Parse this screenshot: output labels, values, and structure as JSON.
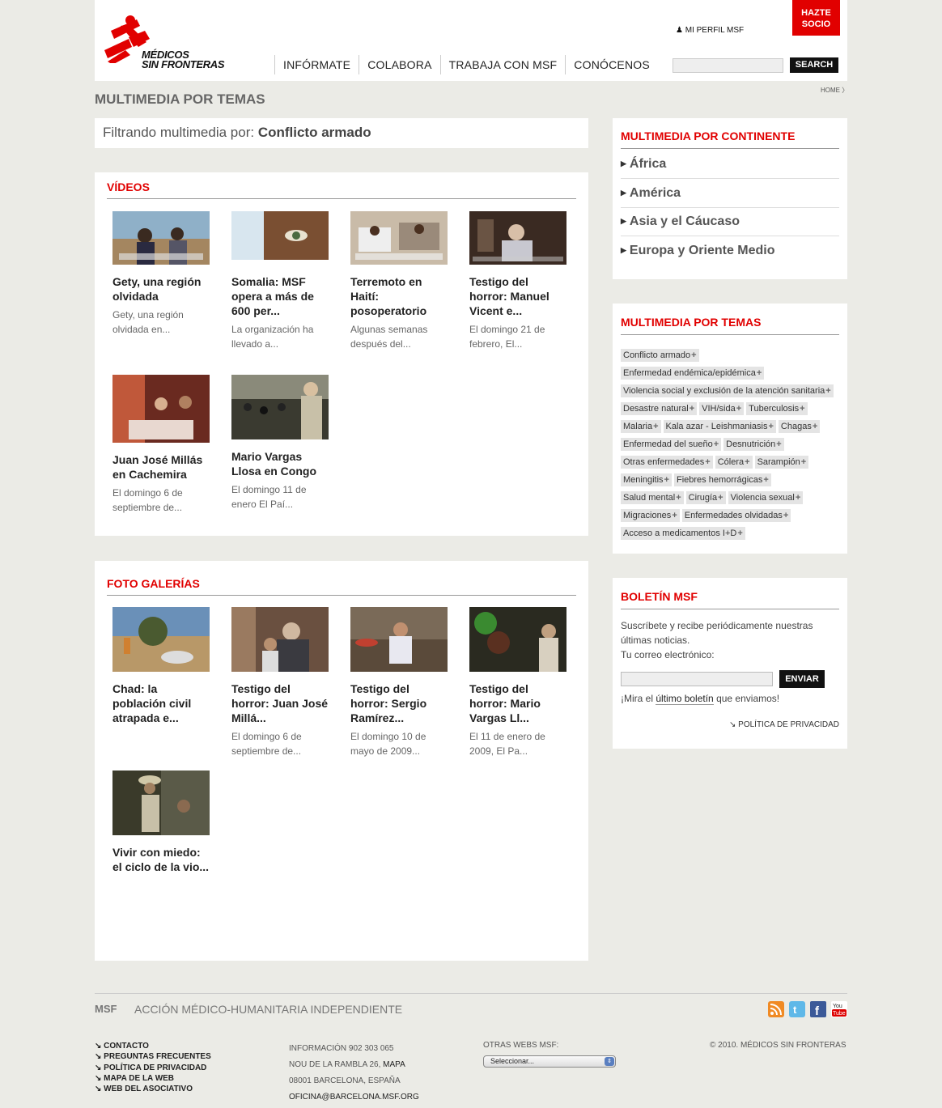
{
  "header": {
    "logo_line1": "MÉDICOS",
    "logo_line2": "SIN FRONTERAS",
    "hazte_line1": "HAZTE",
    "hazte_line2": "SOCIO",
    "perfil": "MI PERFIL MSF",
    "nav": [
      "INFÓRMATE",
      "COLABORA",
      "TRABAJA CON MSF",
      "CONÓCENOS"
    ],
    "search_button": "SEARCH"
  },
  "page": {
    "title": "MULTIMEDIA POR TEMAS",
    "breadcrumb": "HOME 〉",
    "filter_prefix": "Filtrando multimedia por:",
    "filter_value": "Conflicto armado"
  },
  "videos": {
    "heading": "VÍDEOS",
    "items": [
      {
        "title": "Gety, una región olvidada",
        "desc": "Gety, una región olvidada en..."
      },
      {
        "title": "Somalia: MSF opera a más de 600 per...",
        "desc": "La organización ha llevado a..."
      },
      {
        "title": "Terremoto en Haití: posoperatorio",
        "desc": "Algunas semanas después del..."
      },
      {
        "title": "Testigo del horror: Manuel Vicent e...",
        "desc": "El domingo 21 de febrero, El..."
      },
      {
        "title": "Juan José Millás en Cachemira",
        "desc": "El domingo 6 de septiembre de..."
      },
      {
        "title": "Mario Vargas Llosa en Congo",
        "desc": "El domingo 11 de enero El Paí..."
      }
    ]
  },
  "galleries": {
    "heading": "FOTO GALERÍAS",
    "items": [
      {
        "title": "Chad: la población civil atrapada e...",
        "desc": ""
      },
      {
        "title": "Testigo del horror: Juan José Millá...",
        "desc": "El domingo 6 de septiembre de..."
      },
      {
        "title": "Testigo del horror: Sergio Ramírez...",
        "desc": "El domingo 10 de mayo de 2009..."
      },
      {
        "title": "Testigo del horror: Mario Vargas Ll...",
        "desc": "El 11 de enero de 2009, El Pa..."
      },
      {
        "title": "Vivir con miedo: el ciclo de la vio...",
        "desc": ""
      }
    ]
  },
  "sidebar": {
    "continent_heading": "MULTIMEDIA POR CONTINENTE",
    "continents": [
      "África",
      "América",
      "Asia y el Cáucaso",
      "Europa y Oriente Medio"
    ],
    "themes_heading": "MULTIMEDIA POR TEMAS",
    "tags": [
      "Conflicto armado",
      "Enfermedad endémica/epidémica",
      "Violencia social y exclusión de la atención sanitaria",
      "Desastre natural",
      "VIH/sida",
      "Tuberculosis",
      "Malaria",
      "Kala azar - Leishmaniasis",
      "Chagas",
      "Enfermedad del sueño",
      "Desnutrición",
      "Otras enfermedades",
      "Cólera",
      "Sarampión",
      "Meningitis",
      "Fiebres hemorrágicas",
      "Salud mental",
      "Cirugía",
      "Violencia sexual",
      "Migraciones",
      "Enfermedades olvidadas",
      "Acceso a medicamentos I+D"
    ],
    "boletin_heading": "BOLETÍN MSF",
    "boletin_text": "Suscríbete y recibe periódicamente nuestras últimas noticias.",
    "boletin_email_label": "Tu correo electrónico:",
    "boletin_button": "ENVIAR",
    "boletin_link_pre": "¡Mira el",
    "boletin_link": "último boletín",
    "boletin_link_post": "que enviamos!",
    "boletin_privacy": "POLÍTICA DE PRIVACIDAD"
  },
  "footer": {
    "msf": "MSF",
    "tagline": "ACCIÓN MÉDICO-HUMANITARIA INDEPENDIENTE",
    "links": [
      "CONTACTO",
      "PREGUNTAS FRECUENTES",
      "POLÍTICA DE PRIVACIDAD",
      "MAPA DE LA WEB",
      "WEB DEL ASOCIATIVO"
    ],
    "info_phone": "INFORMACIÓN 902 303 065",
    "info_address": "NOU DE LA RAMBLA 26,",
    "info_map": "MAPA",
    "info_city": "08001 BARCELONA, ESPAÑA",
    "info_email": "OFICINA@BARCELONA.MSF.ORG",
    "other_label": "OTRAS WEBS MSF:",
    "select_value": "Seleccionar...",
    "copyright": "© 2010. MÉDICOS SIN FRONTERAS"
  },
  "colors": {
    "brand_red": "#e10000",
    "background": "#ebebe6"
  }
}
